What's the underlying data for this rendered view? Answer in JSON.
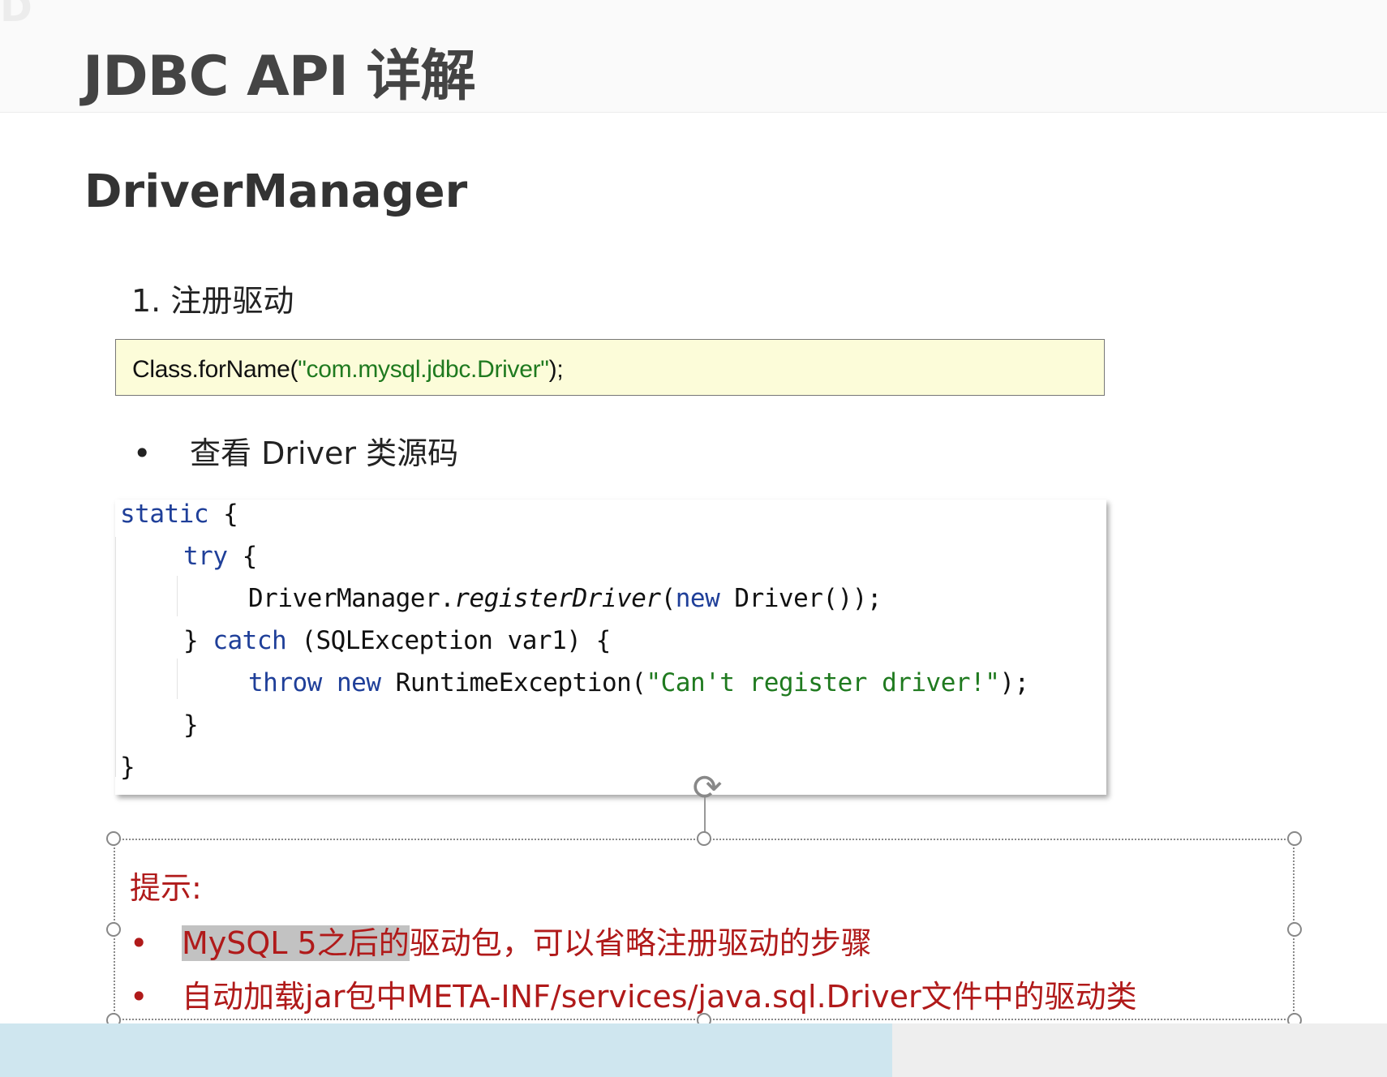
{
  "slide": {
    "title": "JDBC API 详解",
    "section": "DriverManager",
    "step": "1.  注册驱动",
    "code_register": {
      "prefix": "Class.forName(",
      "string": "\"com.mysql.jdbc.Driver\"",
      "suffix": ");"
    },
    "bullet": "查看 Driver 类源码",
    "source": {
      "l1_kw": "static",
      "l1_rest": " {",
      "l2_kw": "try",
      "l2_rest": " {",
      "l3_a": "DriverManager.",
      "l3_method": "registerDriver",
      "l3_b": "(",
      "l3_kw": "new",
      "l3_c": " Driver());",
      "l4_a": "} ",
      "l4_kw": "catch",
      "l4_b": " (SQLException var1) {",
      "l5_kw1": "throw",
      "l5_sp": " ",
      "l5_kw2": "new",
      "l5_a": " RuntimeException(",
      "l5_str": "\"Can't register driver!\"",
      "l5_b": ");",
      "l6": "}",
      "l7": "}"
    },
    "tip_title": "提示:",
    "tips": [
      {
        "highlight": "MySQL 5之后的",
        "rest": "驱动包，可以省略注册驱动的步骤"
      },
      {
        "highlight": "",
        "rest": "自动加载jar包中META-INF/services/java.sql.Driver文件中的驱动类"
      }
    ],
    "bullet_glyph": "•"
  },
  "colors": {
    "keyword": "#1f3f99",
    "string": "#1f7a1f",
    "tip": "#b01a1a",
    "code_bg": "#fcfcd9"
  }
}
